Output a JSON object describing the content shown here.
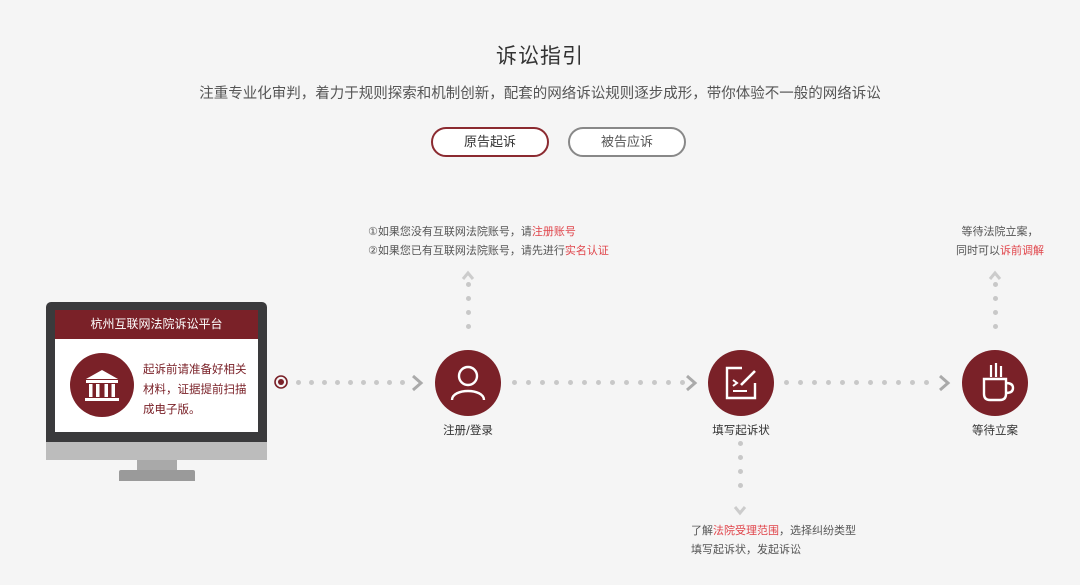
{
  "header": {
    "title": "诉讼指引",
    "subtitle": "注重专业化审判，着力于规则探索和机制创新，配套的网络诉讼规则逐步成形，带你体验不一般的网络诉讼"
  },
  "tabs": [
    {
      "label": "原告起诉",
      "active": true
    },
    {
      "label": "被告应诉",
      "active": false
    }
  ],
  "platform": {
    "title": "杭州互联网法院诉讼平台",
    "icon": "court-building-icon",
    "description": "起诉前请准备好相关材料，证据提前扫描成电子版。"
  },
  "steps": [
    {
      "label": "注册/登录",
      "icon": "user-icon"
    },
    {
      "label": "填写起诉状",
      "icon": "edit-document-icon"
    },
    {
      "label": "等待立案",
      "icon": "coffee-cup-icon"
    }
  ],
  "notes": {
    "register": {
      "line1_prefix": "①如果您没有互联网法院账号，请",
      "line1_link": "注册账号",
      "line2_prefix": "②如果您已有互联网法院账号，请先进行",
      "line2_link": "实名认证"
    },
    "filing": {
      "line1_prefix": "了解",
      "line1_link": "法院受理范围",
      "line1_suffix": "，选择纠纷类型",
      "line2": "填写起诉状，发起诉讼"
    },
    "waiting": {
      "line1": "等待法院立案，",
      "line2_prefix": "同时可以",
      "line2_link": "诉前调解"
    }
  },
  "colors": {
    "brand": "#7a2128",
    "link": "#e0444a",
    "connector": "#c8c8c8",
    "arrow": "#aaaaaa"
  }
}
